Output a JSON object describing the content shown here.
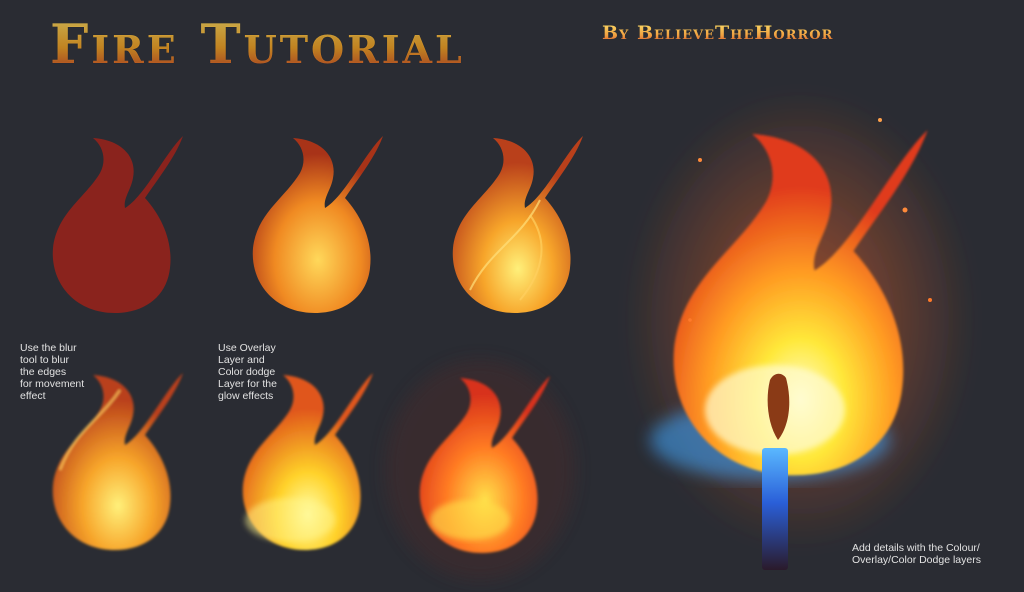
{
  "title": "Fire Tutorial",
  "byline": "By BelieveTheHorror",
  "notes": {
    "blur": "Use the blur\ntool to blur\nthe edges\nfor movement\neffect",
    "overlay": "Use Overlay\nLayer and\nColor dodge\nLayer for the\nglow effects",
    "details": "Add details with the Colour/\nOverlay/Color Dodge layers"
  },
  "colors": {
    "background": "#2a2c33",
    "flat_red": "#8a231d",
    "orange": "#f28a1e",
    "yellow": "#ffe23a",
    "blue_glow": "#3da6ff"
  },
  "illustrations": [
    "flame-step-1-flat",
    "flame-step-2-shaded",
    "flame-step-3-highlights",
    "flame-step-4-blurred",
    "flame-step-5-glow",
    "flame-step-6-dodged",
    "match-flame-final"
  ]
}
